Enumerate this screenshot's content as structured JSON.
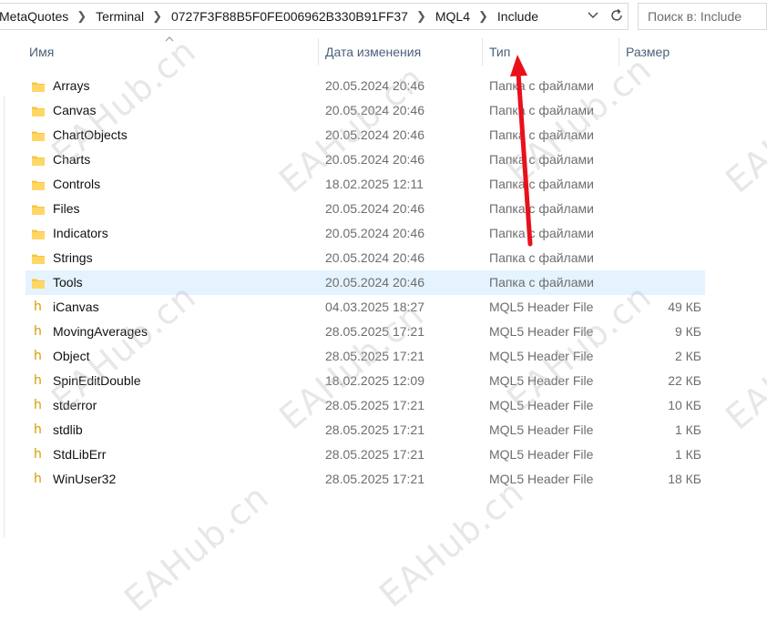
{
  "address_bar": {
    "breadcrumbs": [
      "MetaQuotes",
      "Terminal",
      "0727F3F88B5F0FE006962B330B91FF37",
      "MQL4",
      "Include"
    ]
  },
  "search": {
    "placeholder": "Поиск в: Include"
  },
  "columns": {
    "name": "Имя",
    "date": "Дата изменения",
    "type": "Тип",
    "size": "Размер"
  },
  "files": [
    {
      "name": "Arrays",
      "date": "20.05.2024 20:46",
      "type": "Папка с файлами",
      "size": "",
      "kind": "folder"
    },
    {
      "name": "Canvas",
      "date": "20.05.2024 20:46",
      "type": "Папка с файлами",
      "size": "",
      "kind": "folder"
    },
    {
      "name": "ChartObjects",
      "date": "20.05.2024 20:46",
      "type": "Папка с файлами",
      "size": "",
      "kind": "folder"
    },
    {
      "name": "Charts",
      "date": "20.05.2024 20:46",
      "type": "Папка с файлами",
      "size": "",
      "kind": "folder"
    },
    {
      "name": "Controls",
      "date": "18.02.2025 12:11",
      "type": "Папка с файлами",
      "size": "",
      "kind": "folder"
    },
    {
      "name": "Files",
      "date": "20.05.2024 20:46",
      "type": "Папка с файлами",
      "size": "",
      "kind": "folder"
    },
    {
      "name": "Indicators",
      "date": "20.05.2024 20:46",
      "type": "Папка с файлами",
      "size": "",
      "kind": "folder"
    },
    {
      "name": "Strings",
      "date": "20.05.2024 20:46",
      "type": "Папка с файлами",
      "size": "",
      "kind": "folder"
    },
    {
      "name": "Tools",
      "date": "20.05.2024 20:46",
      "type": "Папка с файлами",
      "size": "",
      "kind": "folder",
      "selected": true
    },
    {
      "name": "iCanvas",
      "date": "04.03.2025 18:27",
      "type": "MQL5 Header File",
      "size": "49 КБ",
      "kind": "header"
    },
    {
      "name": "MovingAverages",
      "date": "28.05.2025 17:21",
      "type": "MQL5 Header File",
      "size": "9 КБ",
      "kind": "header"
    },
    {
      "name": "Object",
      "date": "28.05.2025 17:21",
      "type": "MQL5 Header File",
      "size": "2 КБ",
      "kind": "header"
    },
    {
      "name": "SpinEditDouble",
      "date": "18.02.2025 12:09",
      "type": "MQL5 Header File",
      "size": "22 КБ",
      "kind": "header"
    },
    {
      "name": "stderror",
      "date": "28.05.2025 17:21",
      "type": "MQL5 Header File",
      "size": "10 КБ",
      "kind": "header"
    },
    {
      "name": "stdlib",
      "date": "28.05.2025 17:21",
      "type": "MQL5 Header File",
      "size": "1 КБ",
      "kind": "header"
    },
    {
      "name": "StdLibErr",
      "date": "28.05.2025 17:21",
      "type": "MQL5 Header File",
      "size": "1 КБ",
      "kind": "header"
    },
    {
      "name": "WinUser32",
      "date": "28.05.2025 17:21",
      "type": "MQL5 Header File",
      "size": "18 КБ",
      "kind": "header"
    }
  ],
  "icons": {
    "folder": "folder-icon",
    "header": "h-letter-icon",
    "dropdown": "chevron-down-icon",
    "refresh": "refresh-icon",
    "sort": "sort-up-icon"
  },
  "watermark": "EAHub.cn",
  "colors": {
    "selected_row": "#e5f3ff",
    "folder": "#f8c63c",
    "header_icon": "#d79b00",
    "annotation_arrow": "#e8111b",
    "header_text": "#4c607a"
  }
}
